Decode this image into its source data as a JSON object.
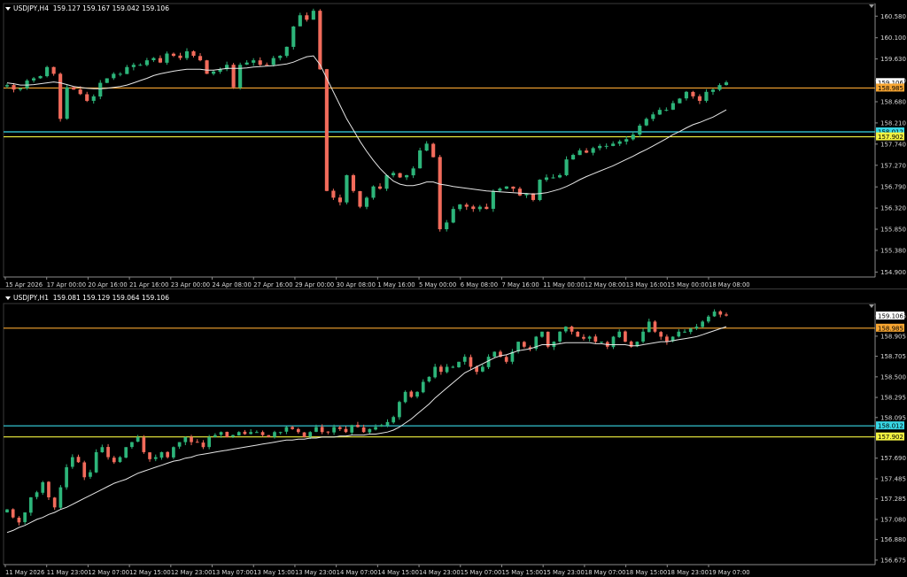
{
  "colors": {
    "background": "#000000",
    "bull": "#2db57a",
    "bear": "#f26b5b",
    "ma": "#e6e6e6",
    "orange_line": "#f7a531",
    "cyan_line": "#38d7e6",
    "yellow_line": "#f2f241",
    "grid_axis": "#8c8c8c"
  },
  "h4": {
    "header": {
      "symbol": "USDJPY,H4",
      "quote": "159.127 159.167 159.042 159.106"
    },
    "y_ticks": [
      "160.580",
      "160.100",
      "159.630",
      "159.150",
      "158.680",
      "158.210",
      "157.740",
      "157.270",
      "156.790",
      "156.320",
      "155.850",
      "155.380",
      "154.900"
    ],
    "x_ticks": [
      "15 Apr 2026",
      "17 Apr 00:00",
      "20 Apr 16:00",
      "21 Apr 16:00",
      "23 Apr 00:00",
      "24 Apr 08:00",
      "27 Apr 16:00",
      "29 Apr 00:00",
      "30 Apr 08:00",
      "1 May 16:00",
      "5 May 00:00",
      "6 May 08:00",
      "7 May 16:00",
      "11 May 00:00",
      "12 May 08:00",
      "13 May 16:00",
      "15 May 00:00",
      "18 May 08:00"
    ],
    "price_labels": {
      "current": "159.106",
      "orange": "158.985",
      "cyan": "158.012",
      "yellow": "157.902"
    }
  },
  "h1": {
    "header": {
      "symbol": "USDJPY,H1",
      "quote": "159.081 159.129 159.064 159.106"
    },
    "y_ticks": [
      "159.106",
      "158.905",
      "158.705",
      "158.500",
      "158.295",
      "158.095",
      "157.690",
      "157.485",
      "157.285",
      "157.080",
      "156.880",
      "156.675"
    ],
    "x_ticks": [
      "11 May 2026",
      "11 May 23:00",
      "12 May 07:00",
      "12 May 15:00",
      "12 May 23:00",
      "13 May 07:00",
      "13 May 15:00",
      "13 May 23:00",
      "14 May 07:00",
      "14 May 15:00",
      "14 May 23:00",
      "15 May 07:00",
      "15 May 15:00",
      "15 May 23:00",
      "18 May 07:00",
      "18 May 15:00",
      "18 May 23:00",
      "19 May 07:00"
    ],
    "price_labels": {
      "current": "159.106",
      "orange": "158.985",
      "cyan": "158.012",
      "yellow": "157.902"
    }
  },
  "chart_data": [
    {
      "type": "candlestick",
      "timeframe": "H4",
      "symbol": "USDJPY",
      "y_range": [
        154.79,
        160.86
      ],
      "horizontal_levels": [
        158.985,
        158.012,
        157.902
      ],
      "closes": [
        159.05,
        158.95,
        158.98,
        159.15,
        159.2,
        159.25,
        159.45,
        159.3,
        158.3,
        159.0,
        158.95,
        158.85,
        158.7,
        158.8,
        159.1,
        159.2,
        159.3,
        159.3,
        159.45,
        159.5,
        159.5,
        159.6,
        159.65,
        159.55,
        159.75,
        159.7,
        159.65,
        159.8,
        159.7,
        159.6,
        159.3,
        159.35,
        159.4,
        159.5,
        159.0,
        159.5,
        159.55,
        159.6,
        159.5,
        159.5,
        159.65,
        159.7,
        159.9,
        160.35,
        160.6,
        160.5,
        160.7,
        159.4,
        156.7,
        156.55,
        156.45,
        157.05,
        156.7,
        156.35,
        156.55,
        156.8,
        156.75,
        157.05,
        157.1,
        157.0,
        157.05,
        157.2,
        157.6,
        157.75,
        157.45,
        155.85,
        156.0,
        156.3,
        156.4,
        156.35,
        156.3,
        156.35,
        156.3,
        156.7,
        156.75,
        156.8,
        156.75,
        156.6,
        156.65,
        156.5,
        156.95,
        157.0,
        157.0,
        157.05,
        157.4,
        157.5,
        157.6,
        157.55,
        157.65,
        157.7,
        157.7,
        157.75,
        157.8,
        157.85,
        157.95,
        158.15,
        158.3,
        158.4,
        158.5,
        158.5,
        158.65,
        158.75,
        158.9,
        158.8,
        158.7,
        158.9,
        158.95,
        159.05,
        159.11
      ],
      "ma": [
        159.1,
        159.08,
        159.05,
        159.05,
        159.06,
        159.08,
        159.1,
        159.12,
        159.1,
        159.06,
        159.02,
        159.0,
        158.98,
        158.97,
        158.97,
        158.98,
        159.0,
        159.02,
        159.05,
        159.1,
        159.15,
        159.2,
        159.26,
        159.3,
        159.33,
        159.36,
        159.38,
        159.4,
        159.4,
        159.4,
        159.38,
        159.38,
        159.4,
        159.42,
        159.42,
        159.42,
        159.43,
        159.45,
        159.46,
        159.47,
        159.48,
        159.5,
        159.52,
        159.56,
        159.62,
        159.68,
        159.7,
        159.5,
        159.2,
        158.9,
        158.6,
        158.3,
        158.05,
        157.8,
        157.58,
        157.38,
        157.2,
        157.05,
        156.92,
        156.85,
        156.82,
        156.82,
        156.85,
        156.9,
        156.9,
        156.85,
        156.83,
        156.8,
        156.78,
        156.76,
        156.74,
        156.72,
        156.7,
        156.69,
        156.68,
        156.67,
        156.66,
        156.65,
        156.64,
        156.63,
        156.64,
        156.66,
        156.7,
        156.74,
        156.8,
        156.87,
        156.95,
        157.02,
        157.08,
        157.14,
        157.2,
        157.26,
        157.33,
        157.4,
        157.47,
        157.55,
        157.62,
        157.7,
        157.78,
        157.86,
        157.95,
        158.02,
        158.1,
        158.17,
        158.22,
        158.28,
        158.34,
        158.42,
        158.5
      ]
    },
    {
      "type": "candlestick",
      "timeframe": "H1",
      "symbol": "USDJPY",
      "y_range": [
        156.63,
        159.23
      ],
      "horizontal_levels": [
        158.985,
        158.012,
        157.902
      ],
      "closes": [
        157.18,
        157.1,
        157.05,
        157.15,
        157.3,
        157.35,
        157.45,
        157.3,
        157.2,
        157.4,
        157.6,
        157.7,
        157.65,
        157.5,
        157.55,
        157.75,
        157.8,
        157.7,
        157.65,
        157.7,
        157.8,
        157.85,
        157.9,
        157.75,
        157.68,
        157.7,
        157.75,
        157.7,
        157.8,
        157.85,
        157.9,
        157.85,
        157.85,
        157.8,
        157.9,
        157.92,
        157.95,
        157.9,
        157.92,
        157.95,
        157.93,
        157.95,
        157.95,
        157.92,
        157.9,
        157.95,
        157.95,
        158.0,
        157.98,
        157.95,
        157.9,
        157.95,
        158.0,
        157.95,
        157.95,
        158.0,
        157.98,
        157.95,
        158.02,
        158.0,
        157.95,
        157.98,
        158.0,
        158.02,
        158.05,
        158.1,
        158.25,
        158.35,
        158.3,
        158.35,
        158.45,
        158.5,
        158.6,
        158.55,
        158.6,
        158.6,
        158.65,
        158.7,
        158.6,
        158.55,
        158.6,
        158.7,
        158.75,
        158.7,
        158.65,
        158.75,
        158.85,
        158.8,
        158.78,
        158.9,
        158.95,
        158.8,
        158.85,
        158.95,
        159.0,
        158.95,
        158.9,
        158.88,
        158.9,
        158.85,
        158.85,
        158.8,
        158.9,
        158.95,
        158.85,
        158.8,
        158.85,
        158.95,
        159.05,
        158.95,
        158.9,
        158.85,
        158.9,
        158.95,
        158.95,
        158.98,
        159.0,
        159.05,
        159.1,
        159.15,
        159.12,
        159.11
      ],
      "ma": [
        156.95,
        156.97,
        157.0,
        157.02,
        157.05,
        157.08,
        157.1,
        157.13,
        157.15,
        157.18,
        157.2,
        157.23,
        157.26,
        157.29,
        157.32,
        157.35,
        157.38,
        157.41,
        157.44,
        157.46,
        157.48,
        157.51,
        157.54,
        157.56,
        157.58,
        157.6,
        157.62,
        157.64,
        157.66,
        157.67,
        157.69,
        157.7,
        157.72,
        157.73,
        157.74,
        157.75,
        157.76,
        157.77,
        157.78,
        157.79,
        157.8,
        157.81,
        157.82,
        157.83,
        157.84,
        157.85,
        157.86,
        157.87,
        157.87,
        157.88,
        157.88,
        157.89,
        157.89,
        157.9,
        157.9,
        157.9,
        157.91,
        157.91,
        157.92,
        157.92,
        157.92,
        157.93,
        157.93,
        157.94,
        157.95,
        157.97,
        158.0,
        158.04,
        158.08,
        158.13,
        158.18,
        158.23,
        158.29,
        158.34,
        158.39,
        158.44,
        158.49,
        158.54,
        158.57,
        158.6,
        158.63,
        158.66,
        158.69,
        158.71,
        158.72,
        158.74,
        158.76,
        158.77,
        158.78,
        158.8,
        158.82,
        158.82,
        158.82,
        158.83,
        158.84,
        158.84,
        158.84,
        158.84,
        158.84,
        158.83,
        158.83,
        158.82,
        158.82,
        158.82,
        158.82,
        158.81,
        158.81,
        158.82,
        158.83,
        158.84,
        158.85,
        158.85,
        158.86,
        158.87,
        158.88,
        158.89,
        158.9,
        158.92,
        158.94,
        158.96,
        158.98,
        159.0
      ]
    }
  ]
}
